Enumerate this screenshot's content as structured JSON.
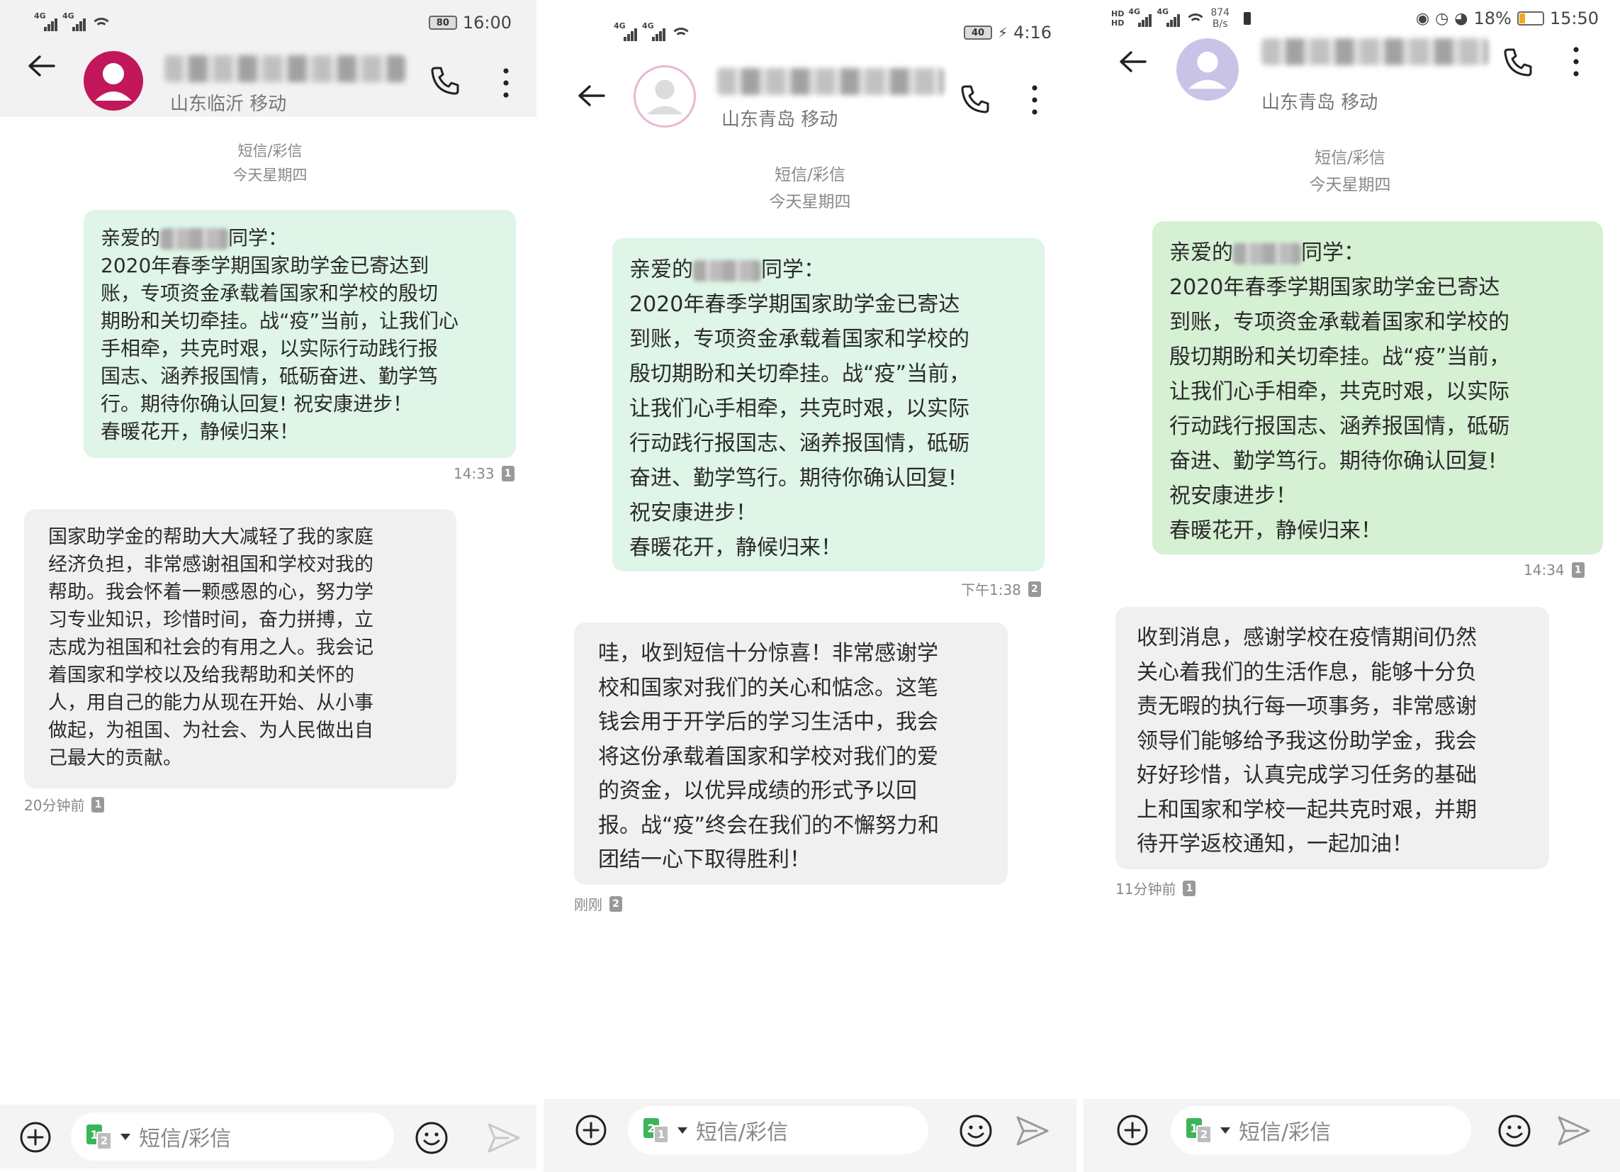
{
  "panels": [
    {
      "status": {
        "battery": "80",
        "time": "16:00"
      },
      "header": {
        "location": "山东临沂 移动"
      },
      "meta": {
        "channel": "短信/彩信",
        "day": "今天星期四"
      },
      "incoming": {
        "greeting_pre": "亲爱的",
        "greeting_post": "同学：",
        "lines": [
          "2020年春季学期国家助学金已寄达到",
          "账，专项资金承载着国家和学校的殷切",
          "期盼和关切牵挂。战“疫”当前，让我们心",
          "手相牵，共克时艰，以实际行动践行报",
          "国志、涵养报国情，砥砺奋进、勤学笃",
          "行。期待你确认回复! 祝安康进步！",
          "春暖花开，静候归来！"
        ],
        "time": "14:33",
        "sim": "1"
      },
      "reply": {
        "lines": [
          "国家助学金的帮助大大减轻了我的家庭",
          "经济负担，非常感谢祖国和学校对我的",
          "帮助。我会怀着一颗感恩的心，努力学",
          "习专业知识，珍惜时间，奋力拼搏，立",
          "志成为祖国和社会的有用之人。我会记",
          "着国家和学校以及给我帮助和关怀的",
          "人，用自己的能力从现在开始、从小事",
          "做起，为祖国、为社会、为人民做出自",
          "己最大的贡献。"
        ],
        "time": "20分钟前",
        "sim": "1"
      },
      "input": {
        "placeholder": "短信/彩信",
        "sim_a": "1",
        "sim_b": "2"
      }
    },
    {
      "status": {
        "battery": "40",
        "time": "4:16"
      },
      "header": {
        "location": "山东青岛 移动"
      },
      "meta": {
        "channel": "短信/彩信",
        "day": "今天星期四"
      },
      "incoming": {
        "greeting_pre": "亲爱的",
        "greeting_post": "同学：",
        "lines": [
          "2020年春季学期国家助学金已寄达",
          "到账，专项资金承载着国家和学校的",
          "殷切期盼和关切牵挂。战“疫”当前，",
          "让我们心手相牵，共克时艰，以实际",
          "行动践行报国志、涵养报国情，砥砺",
          "奋进、勤学笃行。期待你确认回复!",
          "祝安康进步！",
          "春暖花开，静候归来！"
        ],
        "time": "下午1:38",
        "sim": "2"
      },
      "reply": {
        "lines": [
          "哇，收到短信十分惊喜！非常感谢学",
          "校和国家对我们的关心和惦念。这笔",
          "钱会用于开学后的学习生活中，我会",
          "将这份承载着国家和学校对我们的爱",
          "的资金，以优异成绩的形式予以回",
          "报。战“疫”终会在我们的不懈努力和",
          "团结一心下取得胜利！"
        ],
        "time": "刚刚",
        "sim": "2"
      },
      "input": {
        "placeholder": "短信/彩信",
        "sim_a": "2",
        "sim_b": "1"
      }
    },
    {
      "status": {
        "speed": "874",
        "speed_unit": "B/s",
        "battery": "18%",
        "time": "15:50"
      },
      "header": {
        "location": "山东青岛 移动"
      },
      "meta": {
        "channel": "短信/彩信",
        "day": "今天星期四"
      },
      "incoming": {
        "greeting_pre": "亲爱的",
        "greeting_post": "同学：",
        "lines": [
          "2020年春季学期国家助学金已寄达",
          "到账，专项资金承载着国家和学校的",
          "殷切期盼和关切牵挂。战“疫”当前，",
          "让我们心手相牵，共克时艰，以实际",
          "行动践行报国志、涵养报国情，砥砺",
          "奋进、勤学笃行。期待你确认回复!",
          "祝安康进步！",
          "春暖花开，静候归来！"
        ],
        "time": "14:34",
        "sim": "1"
      },
      "reply": {
        "lines": [
          "收到消息，感谢学校在疫情期间仍然",
          "关心着我们的生活作息，能够十分负",
          "责无暇的执行每一项事务，非常感谢",
          "领导们能够给予我这份助学金，我会",
          "好好珍惜，认真完成学习任务的基础",
          "上和国家和学校一起共克时艰，并期",
          "待开学返校通知，一起加油！"
        ],
        "time": "11分钟前",
        "sim": "1"
      },
      "input": {
        "placeholder": "短信/彩信",
        "sim_a": "1",
        "sim_b": "2"
      }
    }
  ],
  "colors": {
    "incoming_tint_1": "#def5e8",
    "incoming_tint_2": "#def5e8",
    "incoming_tint_3": "#d5f0d3",
    "reply_bg": "#f0f0f0",
    "avatar_1": "#c2185b",
    "avatar_2_3": "#c9c3e8",
    "sim_green": "#3cb55a"
  }
}
